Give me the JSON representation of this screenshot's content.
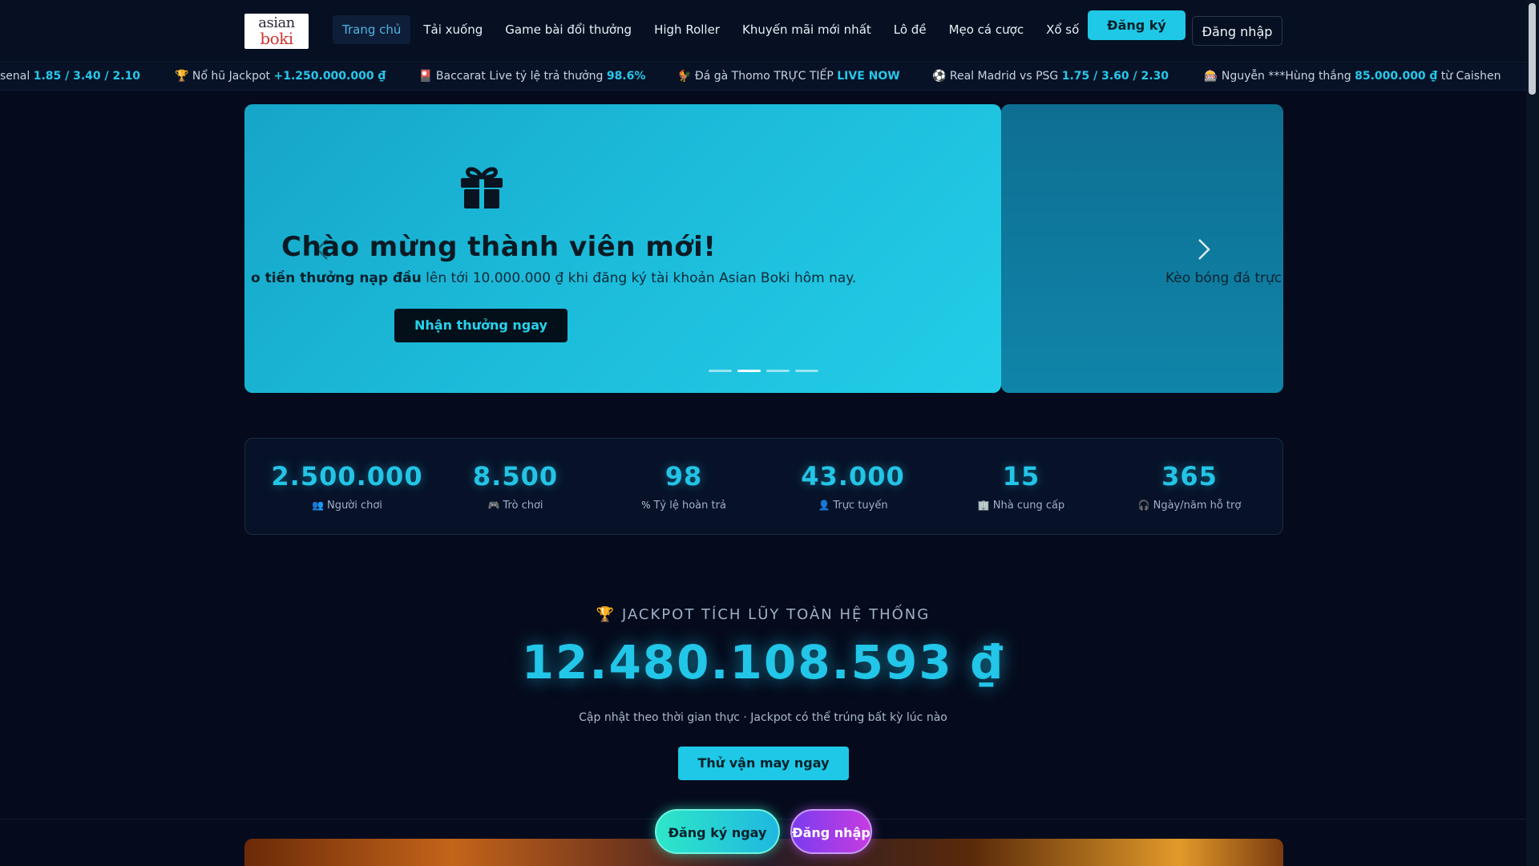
{
  "header": {
    "logo_line1": "asian",
    "logo_line2": "boki",
    "nav": [
      {
        "label": "Trang chủ",
        "active": true
      },
      {
        "label": "Tải xuống"
      },
      {
        "label": "Game bài đổi thưởng"
      },
      {
        "label": "High Roller"
      },
      {
        "label": "Khuyến mãi mới nhất"
      },
      {
        "label": "Lô đề"
      },
      {
        "label": "Mẹo cá cược"
      },
      {
        "label": "Xổ số"
      }
    ],
    "register_label": "Đăng ký",
    "login_label": "Đăng nhập"
  },
  "ticker": [
    {
      "text": "senal ",
      "highlight": "1.85 / 3.40 / 2.10",
      "after": ""
    },
    {
      "text": "🏆 Nổ hũ Jackpot ",
      "highlight": "+1.250.000.000 ₫",
      "after": ""
    },
    {
      "text": "🎴 Baccarat Live tỷ lệ trả thưởng ",
      "highlight": "98.6%",
      "after": ""
    },
    {
      "text": "🐓 Đá gà Thomo TRỰC TIẾP ",
      "highlight": "LIVE NOW",
      "after": ""
    },
    {
      "text": "⚽ Real Madrid vs PSG ",
      "highlight": "1.75 / 3.60 / 2.30",
      "after": ""
    },
    {
      "text": "🎰 Nguyễn ***Hùng thắng ",
      "highlight": "85.000.000 ₫",
      "after": " từ Caishen"
    }
  ],
  "hero": {
    "title": "Chào mừng thành viên mới!",
    "subtitle_bold": "tiền thưởng nạp đầu",
    "subtitle_pre": "o ",
    "subtitle_rest": " lên tới 10.000.000 ₫ khi đăng ký tài khoản Asian Boki hôm nay.",
    "button": "Nhận thưởng ngay",
    "next_subtitle": "Kèo bóng đá trực",
    "slides_count": 4,
    "active_slide": 2,
    "colors": {
      "slide_main": "#1cbad9",
      "slide_next": "#0f85a9"
    }
  },
  "stats": [
    {
      "value": "2.500.000",
      "icon": "users-icon",
      "glyph": "👥",
      "label": "Người chơi"
    },
    {
      "value": "8.500",
      "icon": "gamepad-icon",
      "glyph": "🎮",
      "label": "Trò chơi"
    },
    {
      "value": "98",
      "icon": "percent-icon",
      "glyph": "%",
      "label": "Tỷ lệ hoàn trả"
    },
    {
      "value": "43.000",
      "icon": "user-online-icon",
      "glyph": "👤",
      "label": "Trực tuyến"
    },
    {
      "value": "15",
      "icon": "building-icon",
      "glyph": "🏢",
      "label": "Nhà cung cấp"
    },
    {
      "value": "365",
      "icon": "headset-icon",
      "glyph": "🎧",
      "label": "Ngày/năm hỗ trợ"
    }
  ],
  "jackpot": {
    "title": "🏆 JACKPOT TÍCH LŨY TOÀN HỆ THỐNG",
    "amount": "12.480.108.593 ₫",
    "note": "Cập nhật theo thời gian thực · Jackpot có thể trúng bất kỳ lúc nào",
    "button": "Thử vận may ngay"
  },
  "floating": {
    "register": "Đăng ký ngay",
    "login": "Đăng nhập"
  },
  "colors": {
    "accent": "#1ec8e6",
    "background": "#050b1c",
    "stat_value": "#23c4e6"
  }
}
